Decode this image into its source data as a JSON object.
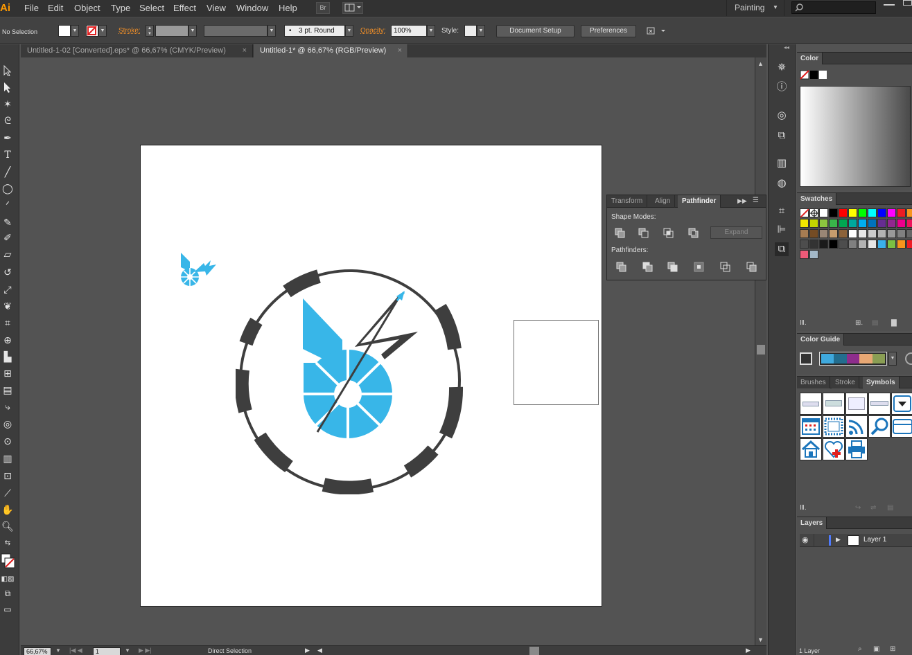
{
  "menubar": {
    "app_logo": "Ai",
    "items": [
      "File",
      "Edit",
      "Object",
      "Type",
      "Select",
      "Effect",
      "View",
      "Window",
      "Help"
    ],
    "bridge_label": "Br",
    "workspace": "Painting"
  },
  "controlbar": {
    "selection_label": "No Selection",
    "stroke_label": "Stroke:",
    "brush_value": "3 pt. Round",
    "opacity_label": "Opacity:",
    "opacity_value": "100%",
    "style_label": "Style:",
    "document_setup": "Document Setup",
    "preferences": "Preferences"
  },
  "tabs": [
    {
      "label": "Untitled-1-02 [Converted].eps* @ 66,67% (CMYK/Preview)",
      "active": false
    },
    {
      "label": "Untitled-1* @ 66,67% (RGB/Preview)",
      "active": true
    }
  ],
  "pathfinder": {
    "tabs": [
      "Transform",
      "Align",
      "Pathfinder"
    ],
    "shape_modes_label": "Shape Modes:",
    "pathfinders_label": "Pathfinders:",
    "expand_label": "Expand"
  },
  "panels": {
    "color_title": "Color",
    "swatches_title": "Swatches",
    "color_guide_title": "Color Guide",
    "brushes_tab": "Brushes",
    "stroke_tab": "Stroke",
    "symbols_tab": "Symbols",
    "layers_title": "Layers",
    "layer_name": "Layer 1",
    "layer_count": "1 Layer"
  },
  "statusbar": {
    "zoom": "66,67%",
    "artboard_number": "1",
    "tool_name": "Direct Selection"
  },
  "colors": {
    "logo_blue": "#38b6e8",
    "ring_dark": "#3e3e3e",
    "accent_orange": "#f18f27"
  },
  "swatches": [
    "#ffffff",
    "#000000",
    "#ff0000",
    "#ffff00",
    "#00ff00",
    "#00ffff",
    "#0000ff",
    "#ff00ff",
    "#ed1c24",
    "#f7941d",
    "#f2e600",
    "#c4d600",
    "#8dc63f",
    "#39b54a",
    "#00a651",
    "#00a99d",
    "#00aeef",
    "#0072bc",
    "#662d91",
    "#92278f",
    "#ec008c",
    "#ed145b",
    "#a67c52",
    "#754c24",
    "#998675",
    "#c69c6d",
    "#8c6239",
    "#ffffff",
    "#e6e6e6",
    "#cccccc",
    "#b3b3b3",
    "#999999",
    "#808080",
    "#666666",
    "#4d4d4d",
    "#333333",
    "#1a1a1a",
    "#000000",
    "#4d4d4d",
    "#808080",
    "#b3b3b3",
    "#e6e6e6",
    "#3ab0ea",
    "#7bc043",
    "#f7941d",
    "#ed1c24",
    "#f05a78",
    "#a3b8c8"
  ],
  "color_guide_colors": [
    "#3fa9dd",
    "#236d8e",
    "#8e2d8c",
    "#e8a874",
    "#8a9e54"
  ]
}
